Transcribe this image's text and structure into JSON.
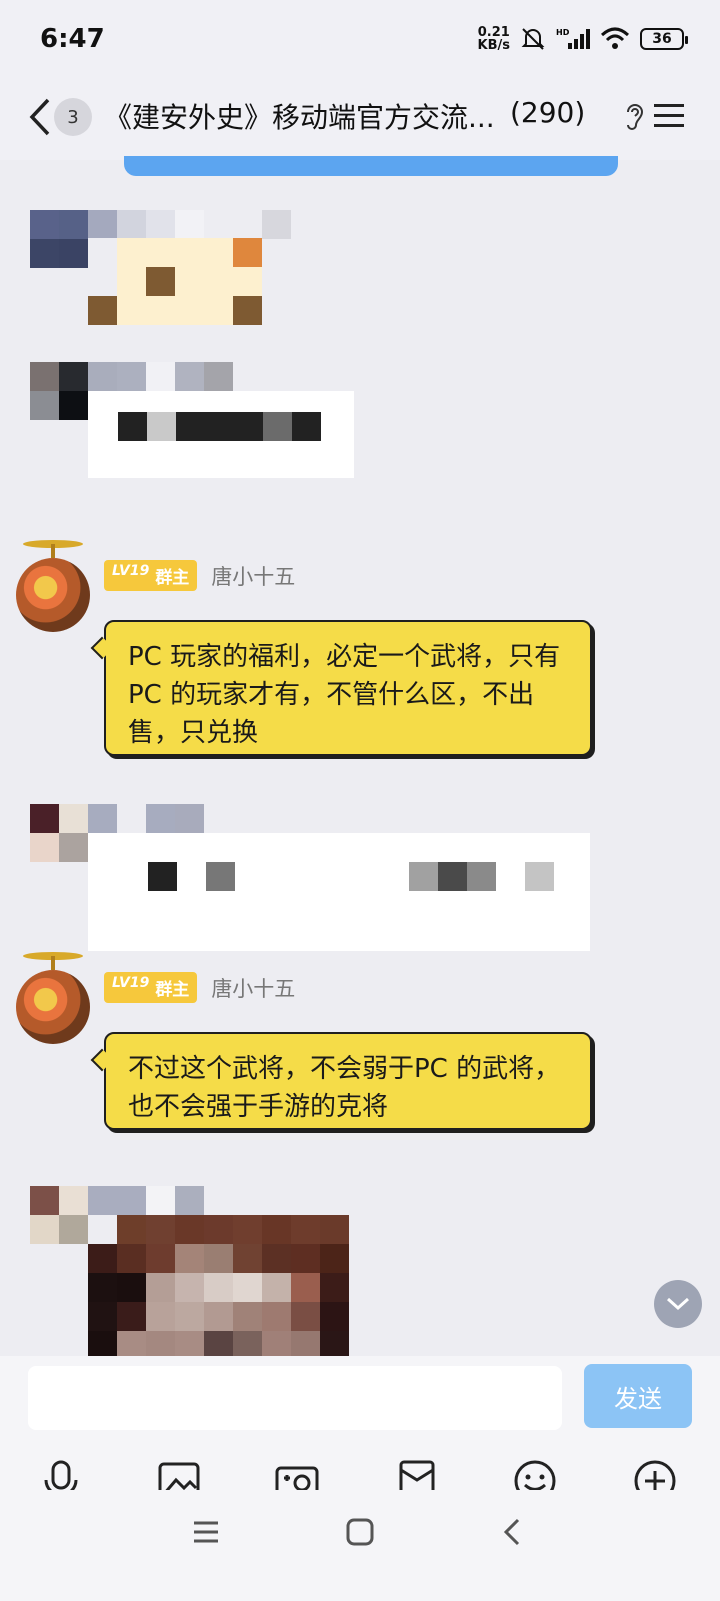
{
  "status": {
    "time": "6:47",
    "netspeed_value": "0.21",
    "netspeed_unit": "KB/s",
    "battery": "36"
  },
  "header": {
    "unread": "3",
    "title": "《建安外史》移动端官方交流...",
    "member_count": "(290)"
  },
  "messages": [
    {
      "level": "LV19",
      "role": "群主",
      "nickname": "唐小十五",
      "text": "PC 玩家的福利，必定一个武将，只有PC 的玩家才有，不管什么区，不出售，只兑换"
    },
    {
      "level": "LV19",
      "role": "群主",
      "nickname": "唐小十五",
      "text": "不过这个武将，不会弱于PC 的武将，也不会强于手游的克将"
    }
  ],
  "composer": {
    "placeholder": "",
    "send_label": "发送"
  },
  "colors": {
    "bubble": "#f5dc48",
    "tag": "#f6c83c",
    "send": "#8cc4f5",
    "accent": "#4b9cf0"
  },
  "icons": [
    "microphone-icon",
    "image-icon",
    "camera-icon",
    "red-packet-icon",
    "emoji-icon",
    "plus-icon"
  ]
}
